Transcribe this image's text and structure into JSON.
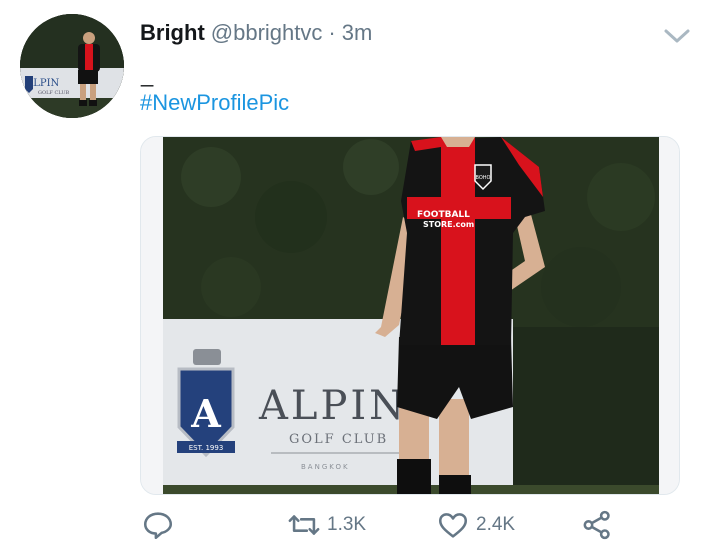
{
  "tweet": {
    "display_name": "Bright",
    "handle": "@bbrightvc",
    "separator": "·",
    "time": "3m",
    "body_line": "_",
    "hashtag": "#NewProfilePic"
  },
  "photo": {
    "jersey_sponsor_line1": "FOOTBALL",
    "jersey_sponsor_line2": "STORE.com",
    "crest_badge": "BOHO",
    "sign_brand": "ALPIN",
    "sign_sub": "GOLF CLUB",
    "sign_place": "BANGKOK",
    "sign_logo_letter": "A",
    "sign_logo_ribbon": "EST. 1993"
  },
  "avatar_sign": {
    "brand": "ALPIN",
    "sub": "GOLF CLUB"
  },
  "actions": {
    "retweets": "1.3K",
    "likes": "2.4K"
  },
  "colors": {
    "link": "#1b95e0",
    "secondary_text": "#657786",
    "jersey_red": "#d8121c",
    "jersey_black": "#141414"
  }
}
